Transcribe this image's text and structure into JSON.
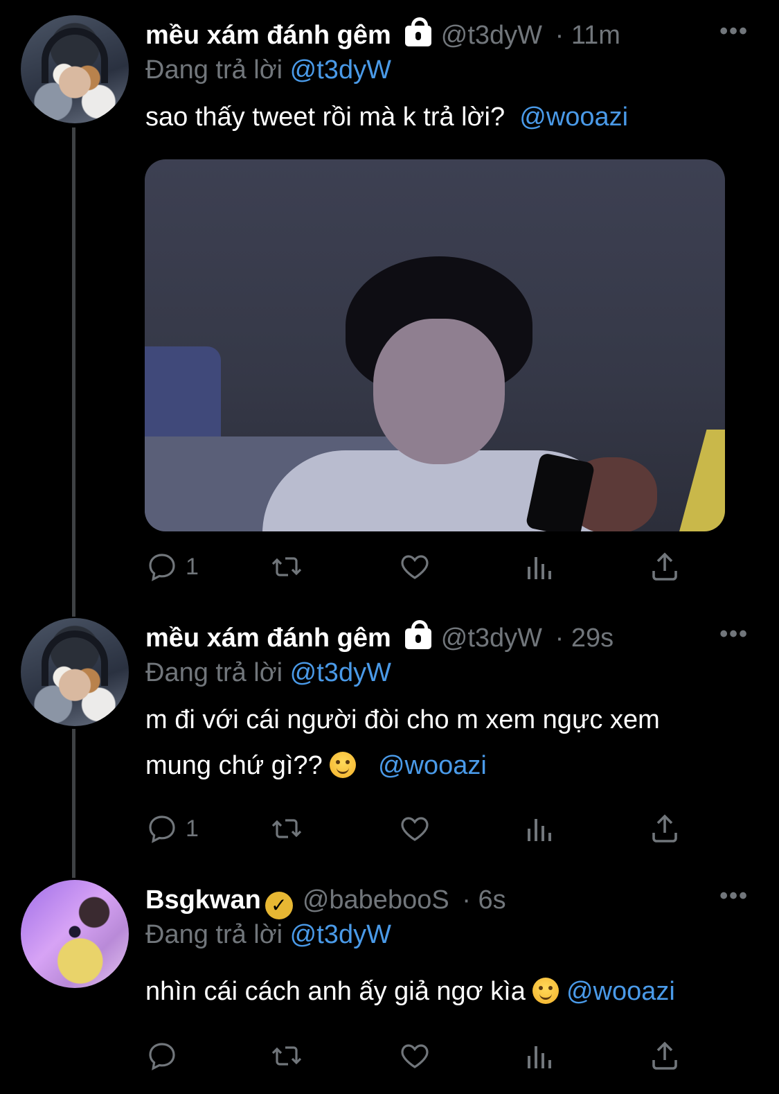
{
  "tweets": [
    {
      "display_name": "mều xám đánh gêm",
      "handle": "@t3dyW",
      "time": "· 11m",
      "replying_label": "Đang trả lời",
      "replying_to": "@t3dyW",
      "text": "sao thấy tweet rồi mà k trả lời?",
      "text_mention": "@wooazi",
      "reply_count": "1",
      "avatar": "cat-with-headset",
      "has_media": true
    },
    {
      "display_name": "mều xám đánh gêm",
      "handle": "@t3dyW",
      "time": "· 29s",
      "replying_label": "Đang trả lời",
      "replying_to": "@t3dyW",
      "text_line1": "m đi với cái người đòi cho m xem ngực xem",
      "text_line2": "mung chứ gì??",
      "text_mention": "@wooazi",
      "emoji": "smirking-face",
      "reply_count": "1",
      "avatar": "cat-with-headset"
    },
    {
      "display_name": "Bsgkwan",
      "verified": true,
      "handle": "@babebooS",
      "time": "· 6s",
      "replying_label": "Đang trả lời",
      "replying_to": "@t3dyW",
      "text": "nhìn cái cách anh ấy giả ngơ kìa",
      "emoji": "smiling-face",
      "text_mention": "@wooazi",
      "avatar": "person-selfie-purple"
    }
  ],
  "icons": [
    "lock-icon",
    "verified-icon",
    "more-icon",
    "reply-icon",
    "retweet-icon",
    "like-icon",
    "views-icon",
    "share-icon"
  ],
  "colors": {
    "background": "#000000",
    "secondary_text": "#71767b",
    "mention": "#4a9ae8",
    "verified": "#e7b733"
  }
}
